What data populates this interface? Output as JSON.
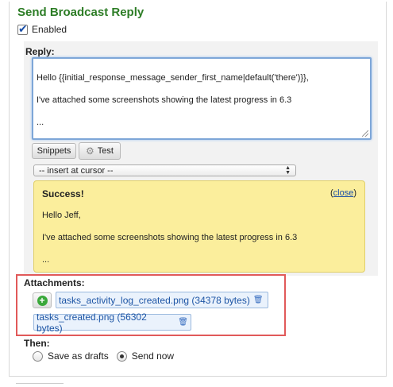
{
  "section": {
    "title": "Send Broadcast Reply",
    "enabled_label": "Enabled",
    "enabled_checked": true
  },
  "reply": {
    "label": "Reply:",
    "text": "Hello {{initial_response_message_sender_first_name|default('there')}},\n\nI've attached some screenshots showing the latest progress in 6.3\n\n..."
  },
  "toolbar": {
    "snippets_label": "Snippets",
    "test_label": "Test",
    "test_icon": "gear-icon"
  },
  "insert_select": {
    "selected": "-- insert at cursor --"
  },
  "success": {
    "title": "Success!",
    "close_label": "close",
    "body": "Hello Jeff,\n\nI've attached some screenshots showing the latest progress in 6.3\n\n..."
  },
  "attachments": {
    "label": "Attachments:",
    "files": [
      {
        "name": "tasks_activity_log_created.png (34378 bytes)"
      },
      {
        "name": "tasks_created.png (56302 bytes)"
      }
    ]
  },
  "then": {
    "label": "Then:",
    "options": [
      {
        "label": "Save as drafts",
        "selected": false
      },
      {
        "label": "Send now",
        "selected": true
      }
    ]
  },
  "colors": {
    "title_green": "#2d7d26",
    "success_yellow": "#fbee9c",
    "highlight_red": "#e15a5a",
    "link_blue": "#1a4fa8"
  }
}
